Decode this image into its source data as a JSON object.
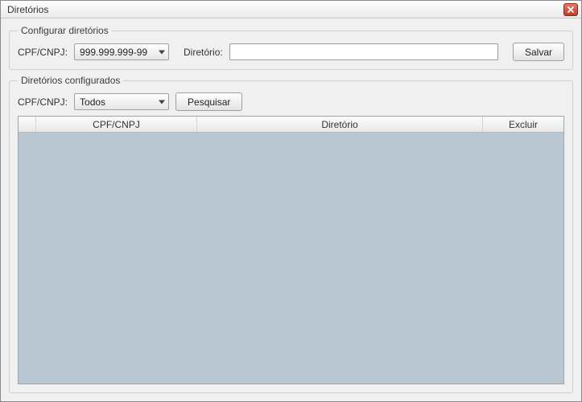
{
  "window": {
    "title": "Diretórios"
  },
  "configure": {
    "legend": "Configurar diretórios",
    "cpf_label": "CPF/CNPJ:",
    "cpf_value": "999.999.999-99",
    "dir_label": "Diretório:",
    "dir_value": "",
    "save_label": "Salvar"
  },
  "configured": {
    "legend": "Diretórios configurados",
    "cpf_label": "CPF/CNPJ:",
    "filter_value": "Todos",
    "search_label": "Pesquisar",
    "columns": {
      "blank": "",
      "cpf": "CPF/CNPJ",
      "dir": "Diretório",
      "excl": "Excluir"
    },
    "rows": []
  }
}
